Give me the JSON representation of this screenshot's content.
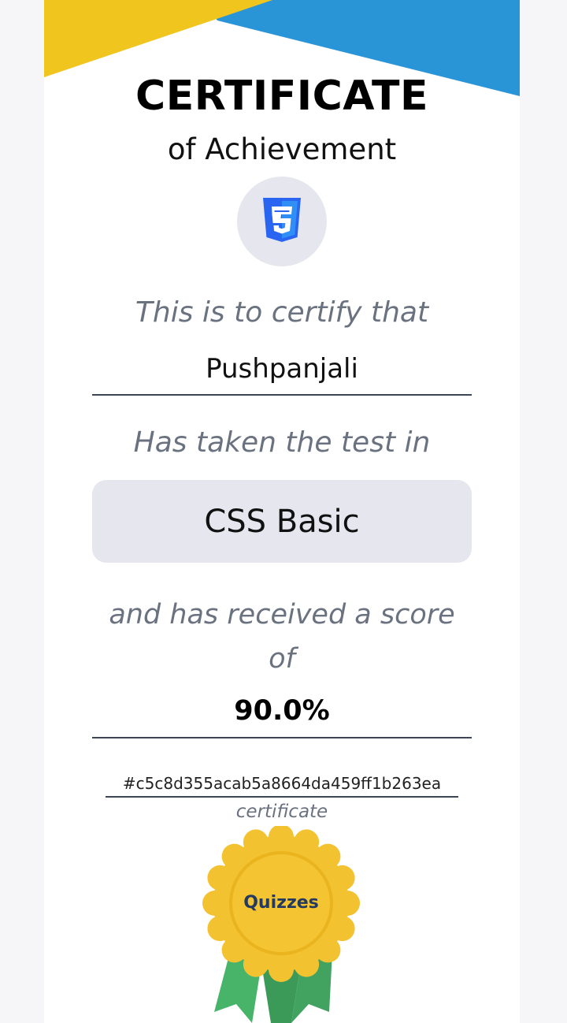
{
  "certificate": {
    "title": "CERTIFICATE",
    "subtitle": "of Achievement",
    "logo_icon": "css3-icon",
    "certify_text": "This is to certify that",
    "recipient_name": "Pushpanjali",
    "taken_text": "Has taken the test in",
    "test_name": "CSS Basic",
    "score_text": "and has received a score of",
    "score": "90.0%",
    "certificate_id": "#c5c8d355acab5a8664da459ff1b263ea",
    "certificate_label": "certificate",
    "badge_text": "Quizzes"
  },
  "colors": {
    "banner_yellow": "#f0c51e",
    "banner_blue": "#2a95d6",
    "css3_blue": "#2965f1",
    "badge_gold": "#f2c230",
    "ribbon_green": "#48b46a"
  }
}
